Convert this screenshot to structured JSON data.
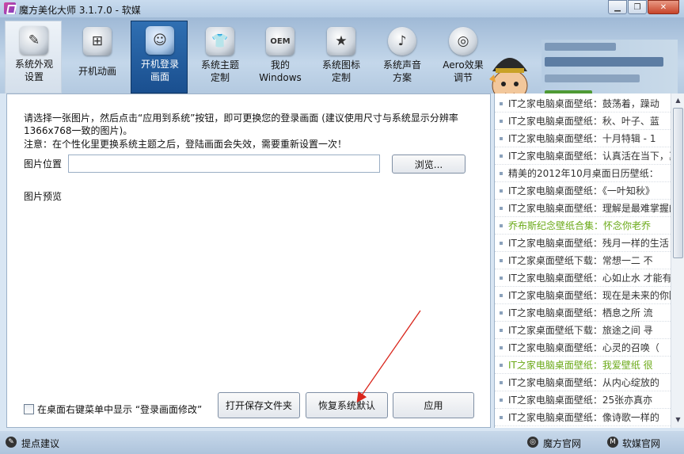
{
  "window": {
    "title": "魔方美化大师 3.1.7.0 - 软媒",
    "min_icon": "minimize-icon",
    "restore_icon": "restore-icon",
    "close_icon": "close-icon"
  },
  "toolbar": {
    "items": [
      {
        "label": "系统外观\n设置",
        "icon": "brush-icon",
        "state": "hover"
      },
      {
        "label": "开机动画",
        "icon": "windows-logo-icon",
        "state": "normal"
      },
      {
        "label": "开机登录\n画面",
        "icon": "user-login-icon",
        "state": "active"
      },
      {
        "label": "系统主题\n定制",
        "icon": "tshirt-icon",
        "state": "normal"
      },
      {
        "label": "我的\nWindows",
        "icon": "oem-icon",
        "state": "normal"
      },
      {
        "label": "系统图标\n定制",
        "icon": "star-icon",
        "state": "normal"
      },
      {
        "label": "系统声音\n方案",
        "icon": "music-note-icon",
        "state": "normal"
      },
      {
        "label": "Aero效果\n调节",
        "icon": "aero-icon",
        "state": "normal"
      }
    ]
  },
  "main": {
    "instruction_line1": "请选择一张图片，然后点击“应用到系统”按钮，即可更换您的登录画面 (建议使用尺寸与系统显示分辨率",
    "instruction_line2": "1366x768一致的图片)。",
    "notice": "注意：在个性化里更换系统主题之后，登陆画面会失效，需要重新设置一次！",
    "path_label": "图片位置",
    "path_value": "",
    "browse_label": "浏览...",
    "preview_label": "图片预览",
    "context_menu_checkbox_label": "在桌面右键菜单中显示 “登录画面修改”",
    "context_menu_checked": false,
    "open_folder_label": "打开保存文件夹",
    "restore_default_label": "恢复系统默认",
    "apply_label": "应用"
  },
  "news": [
    {
      "text": "IT之家电脑桌面壁纸：鼓荡着，躁动",
      "highlight": false
    },
    {
      "text": "IT之家电脑桌面壁纸：秋、叶子、蓝",
      "highlight": false
    },
    {
      "text": "IT之家电脑桌面壁纸：十月特辑 - 1",
      "highlight": false
    },
    {
      "text": "IT之家电脑桌面壁纸：认真活在当下，真",
      "highlight": false
    },
    {
      "text": "精美的2012年10月桌面日历壁纸：",
      "highlight": false
    },
    {
      "text": "IT之家电脑桌面壁纸：《一叶知秋》",
      "highlight": false
    },
    {
      "text": "IT之家电脑桌面壁纸：理解是最难掌握的",
      "highlight": false
    },
    {
      "text": "乔布斯纪念壁纸合集：怀念你老乔",
      "highlight": true
    },
    {
      "text": "IT之家电脑桌面壁纸：残月一样的生活",
      "highlight": false
    },
    {
      "text": "IT之家桌面壁纸下载：常想一二 不",
      "highlight": false
    },
    {
      "text": "IT之家电脑桌面壁纸：心如止水 才能有",
      "highlight": false
    },
    {
      "text": "IT之家电脑桌面壁纸：现在是未来的你回",
      "highlight": false
    },
    {
      "text": "IT之家电脑桌面壁纸：栖息之所 流",
      "highlight": false
    },
    {
      "text": "IT之家桌面壁纸下载：旅途之间 寻",
      "highlight": false
    },
    {
      "text": "IT之家电脑桌面壁纸：心灵的召唤（",
      "highlight": false
    },
    {
      "text": "IT之家电脑桌面壁纸：我爱壁纸 很",
      "highlight": true
    },
    {
      "text": "IT之家电脑桌面壁纸：从内心绽放的",
      "highlight": false
    },
    {
      "text": "IT之家电脑桌面壁纸：25张亦真亦",
      "highlight": false
    },
    {
      "text": "IT之家电脑桌面壁纸：像诗歌一样的",
      "highlight": false
    }
  ],
  "status": {
    "feedback_label": "提点建议",
    "mofang_site_label": "魔方官网",
    "ruanmei_site_label": "软媒官网"
  },
  "colors": {
    "accent_active": "#1a4f8f",
    "news_highlight": "#6aa917",
    "annotation_arrow": "#d9261c"
  }
}
